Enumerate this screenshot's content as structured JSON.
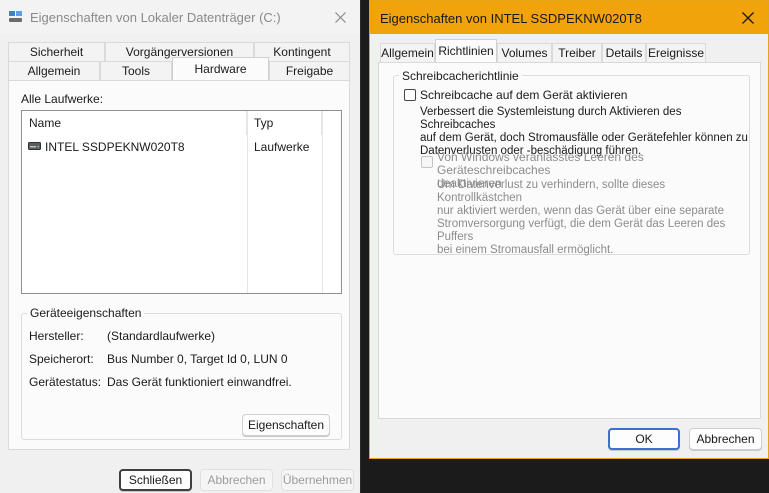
{
  "left_dialog": {
    "title": "Eigenschaften von Lokaler Datenträger (C:)",
    "tabs_row_back": [
      "Sicherheit",
      "Vorgängerversionen",
      "Kontingent"
    ],
    "tabs_row_front": [
      "Allgemein",
      "Tools",
      "Hardware",
      "Freigabe"
    ],
    "active_tab": "Hardware",
    "all_drives_label": "Alle Laufwerke:",
    "list": {
      "columns": [
        "Name",
        "Typ"
      ],
      "rows": [
        {
          "name": "INTEL SSDPEKNW020T8",
          "type": "Laufwerke",
          "icon": "drive-icon"
        }
      ]
    },
    "device_properties": {
      "title": "Geräteeigenschaften",
      "rows": [
        {
          "label": "Hersteller:",
          "value": "(Standardlaufwerke)"
        },
        {
          "label": "Speicherort:",
          "value": "Bus Number 0, Target Id 0, LUN 0"
        },
        {
          "label": "Gerätestatus:",
          "value": "Das Gerät funktioniert einwandfrei."
        }
      ],
      "properties_button": "Eigenschaften"
    },
    "buttons": {
      "close": "Schließen",
      "cancel": "Abbrechen",
      "apply": "Übernehmen"
    }
  },
  "right_dialog": {
    "title": "Eigenschaften von INTEL SSDPEKNW020T8",
    "accent": "#f0a30a",
    "tabs": [
      "Allgemein",
      "Richtlinien",
      "Volumes",
      "Treiber",
      "Details",
      "Ereignisse"
    ],
    "active_tab": "Richtlinien",
    "group_title": "Schreibcacherichtlinie",
    "write_cache": {
      "label": "Schreibcache auf dem Gerät aktivieren",
      "checked": false,
      "description": [
        "Verbessert die Systemleistung durch Aktivieren des Schreibcaches",
        "auf dem Gerät, doch Stromausfälle oder Gerätefehler können zu",
        "Datenverlusten oder -beschädigung führen."
      ]
    },
    "flush": {
      "label": [
        "Von Windows veranlasstes Leeren des Geräteschreibcaches",
        "deaktivieren"
      ],
      "checked": false,
      "disabled": true,
      "description": [
        "Um Datenverlust zu verhindern, sollte dieses Kontrollkästchen",
        "nur aktiviert werden, wenn das Gerät über eine separate",
        "Stromversorgung verfügt, die dem Gerät das Leeren des Puffers",
        "bei einem Stromausfall ermöglicht."
      ]
    },
    "buttons": {
      "ok": "OK",
      "cancel": "Abbrechen"
    }
  }
}
